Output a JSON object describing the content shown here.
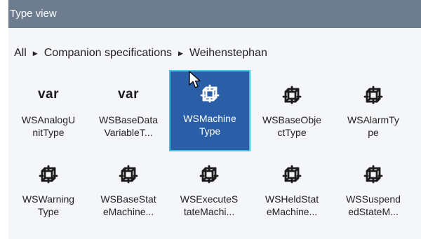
{
  "panel": {
    "title": "Type view"
  },
  "breadcrumb": {
    "items": [
      "All",
      "Companion specifications",
      "Weihenstephan"
    ]
  },
  "items": [
    {
      "icon": "var",
      "line1": "WSAnalogU",
      "line2": "nitType",
      "selected": false
    },
    {
      "icon": "var",
      "line1": "WSBaseData",
      "line2": "VariableT...",
      "selected": false
    },
    {
      "icon": "object-type",
      "line1": "WSMachine",
      "line2": "Type",
      "selected": true
    },
    {
      "icon": "object-type",
      "line1": "WSBaseObje",
      "line2": "ctType",
      "selected": false
    },
    {
      "icon": "object-type",
      "line1": "WSAlarmTy",
      "line2": "pe",
      "selected": false
    },
    {
      "icon": "object-type",
      "line1": "WSWarning",
      "line2": "Type",
      "selected": false
    },
    {
      "icon": "object-type",
      "line1": "WSBaseStat",
      "line2": "eMachine...",
      "selected": false
    },
    {
      "icon": "object-type",
      "line1": "WSExecuteS",
      "line2": "tateMachi...",
      "selected": false
    },
    {
      "icon": "object-type",
      "line1": "WSHeldStat",
      "line2": "eMachine...",
      "selected": false
    },
    {
      "icon": "object-type",
      "line1": "WSSuspend",
      "line2": "edStateM...",
      "selected": false
    }
  ],
  "colors": {
    "titlebar": "#6d7d8f",
    "selected_bg": "#2a5ea6",
    "selected_border": "#36c7e6"
  }
}
